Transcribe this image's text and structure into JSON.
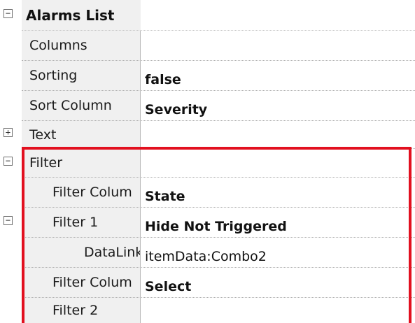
{
  "category": {
    "title": "Alarms List",
    "expander_icon": "minus-box-icon"
  },
  "properties": [
    {
      "label": "Columns",
      "value": "",
      "bold": false
    },
    {
      "label": "Sorting",
      "value": "false",
      "bold": true
    },
    {
      "label": "Sort Column",
      "value": "Severity",
      "bold": true
    },
    {
      "label": "Text",
      "value": "",
      "bold": false,
      "expander": "+"
    },
    {
      "label": "Filter",
      "value": "",
      "bold": false,
      "expander": "−"
    },
    {
      "label": "Filter Colum",
      "value": "State",
      "bold": true
    },
    {
      "label": "Filter 1",
      "value": "Hide Not Triggered",
      "bold": true,
      "expander": "−"
    },
    {
      "label": "DataLink",
      "value": "itemData:Combo2",
      "bold": false
    },
    {
      "label": "Filter Colum",
      "value": "Select",
      "bold": true
    },
    {
      "label": "Filter 2",
      "value": "",
      "bold": false
    }
  ],
  "colors": {
    "highlight": "#e2101f",
    "label_background": "#f0f0f0"
  }
}
